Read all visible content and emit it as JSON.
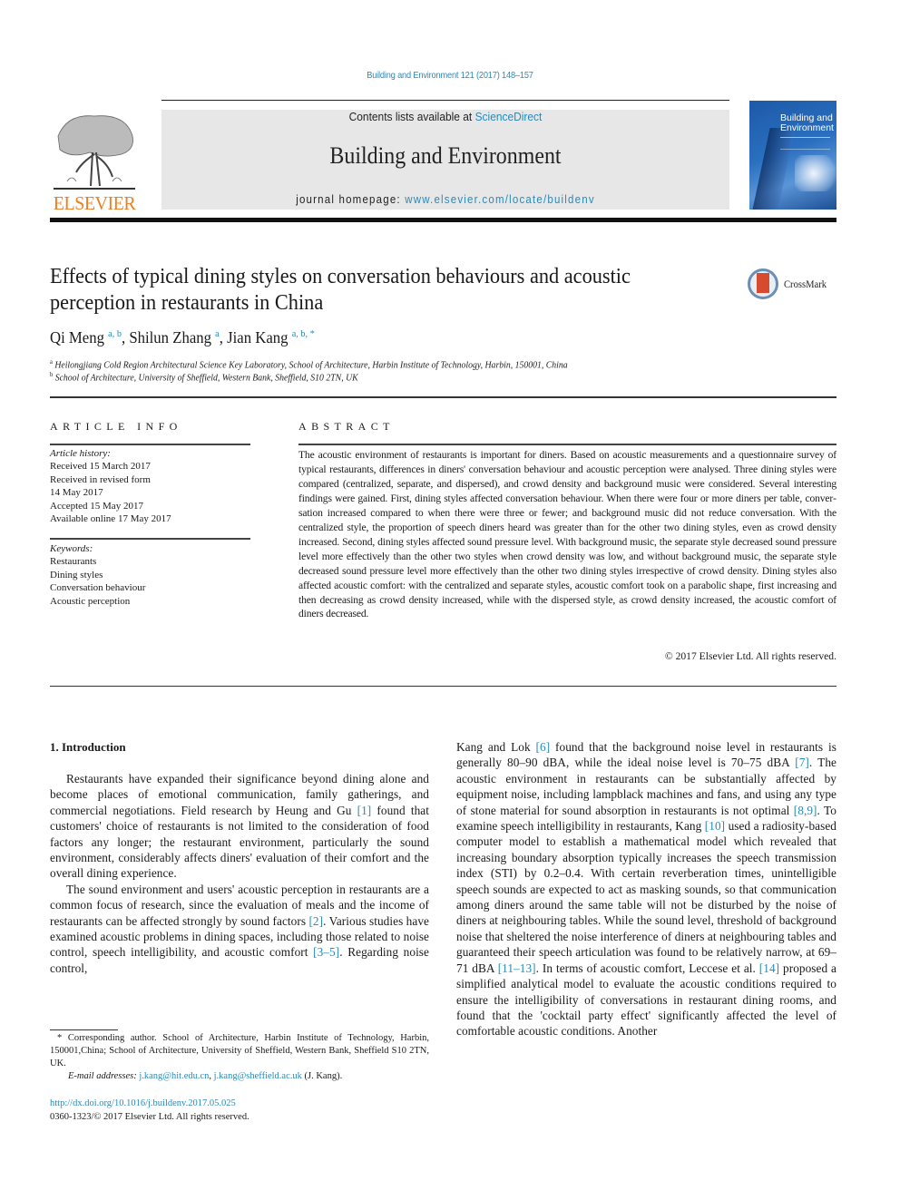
{
  "header": {
    "citation": "Building and Environment 121 (2017) 148–157",
    "contents_prefix": "Contents lists available at ",
    "contents_link": "ScienceDirect",
    "journal_name": "Building and Environment",
    "homepage_prefix": "journal homepage: ",
    "homepage_link": "www.elsevier.com/locate/buildenv",
    "publisher_logo_text": "ELSEVIER",
    "cover_title": "Building and Environment",
    "crossmark_label": "CrossMark",
    "colors": {
      "link": "#2a8ab8",
      "elsevier_orange": "#f07e1e",
      "masthead_bg": "#e7e7e7"
    }
  },
  "article": {
    "title": "Effects of typical dining styles on conversation behaviours and acoustic perception in restaurants in China",
    "authors": [
      {
        "name": "Qi Meng",
        "affils": "a, b"
      },
      {
        "name": "Shilun Zhang",
        "affils": "a"
      },
      {
        "name": "Jian Kang",
        "affils": "a, b, *"
      }
    ],
    "affiliations": [
      {
        "mark": "a",
        "text": "Heilongjiang Cold Region Architectural Science Key Laboratory, School of Architecture, Harbin Institute of Technology, Harbin, 150001, China"
      },
      {
        "mark": "b",
        "text": "School of Architecture, University of Sheffield, Western Bank, Sheffield, S10 2TN, UK"
      }
    ]
  },
  "article_info": {
    "heading": "ARTICLE INFO",
    "history_label": "Article history:",
    "history": [
      "Received 15 March 2017",
      "Received in revised form",
      "14 May 2017",
      "Accepted 15 May 2017",
      "Available online 17 May 2017"
    ],
    "keywords_label": "Keywords:",
    "keywords": [
      "Restaurants",
      "Dining styles",
      "Conversation behaviour",
      "Acoustic perception"
    ]
  },
  "abstract": {
    "heading": "ABSTRACT",
    "text": "The acoustic environment of restaurants is important for diners. Based on acoustic measurements and a questionnaire survey of typical restaurants, differences in diners' conversation behaviour and acoustic perception were analysed. Three dining styles were compared (centralized, separate, and dispersed), and crowd density and background music were considered. Several interesting findings were gained. First, dining styles affected conversation behaviour. When there were four or more diners per table, conver­sation increased compared to when there were three or fewer; and background music did not reduce conversation. With the centralized style, the proportion of speech diners heard was greater than for the other two dining styles, even as crowd density increased. Second, dining styles affected sound pressure level. With background music, the separate style decreased sound pressure level more effectively than the other two styles when crowd density was low, and without background music, the separate style decreased sound pressure level more effectively than the other two dining styles irrespective of crowd density. Dining styles also affected acoustic comfort: with the centralized and separate styles, acoustic comfort took on a parabolic shape, first increasing and then decreasing as crowd density increased, while with the dispersed style, as crowd density increased, the acoustic comfort of diners decreased.",
    "copyright": "© 2017 Elsevier Ltd. All rights reserved."
  },
  "body": {
    "intro_heading": "1.  Introduction",
    "left_paragraphs": [
      [
        {
          "t": "Restaurants have expanded their significance beyond dining alone and become places of emotional communication, family gatherings, and commercial negotiations. Field research by Heung and Gu "
        },
        {
          "ref": "[1]"
        },
        {
          "t": " found that customers' choice of restaurants is not limited to the consideration of food factors any longer; the restaurant environment, particularly the sound environment, considerably affects diners' evaluation of their comfort and the overall dining experience."
        }
      ],
      [
        {
          "t": "The sound environment and users' acoustic perception in res­taurants are a common focus of research, since the evaluation of meals and the income of restaurants can be affected strongly by sound factors "
        },
        {
          "ref": "[2]"
        },
        {
          "t": ". Various studies have examined acoustic problems in dining spaces, including those related to noise control, speech intelligibility, and acoustic comfort "
        },
        {
          "ref": "[3–5]"
        },
        {
          "t": ". Regarding noise control,"
        }
      ]
    ],
    "right_paragraph": [
      {
        "t": "Kang and Lok "
      },
      {
        "ref": "[6]"
      },
      {
        "t": " found that the background noise level in restau­rants is generally 80–90 dBA, while the ideal noise level is 70–75 dBA "
      },
      {
        "ref": "[7]"
      },
      {
        "t": ". The acoustic environment in restaurants can be substan­tially affected by equipment noise, including lampblack machines and fans, and using any type of stone material for sound absorption in restaurants is not optimal "
      },
      {
        "ref": "[8,9]"
      },
      {
        "t": ". To examine speech intelligibility in restaurants, Kang "
      },
      {
        "ref": "[10]"
      },
      {
        "t": " used a radiosity-based computer model to establish a mathematical model which revealed that increasing boundary absorption typically increases the speech transmission index (STI) by 0.2–0.4. With certain reverberation times, unintel­ligible speech sounds are expected to act as masking sounds, so that communication among diners around the same table will not be disturbed by the noise of diners at neighbouring tables. While the sound level, threshold of background noise that sheltered the noise interference of diners at neighbouring tables and guaranteed their speech articulation was found to be relatively narrow, at 69–71 dBA "
      },
      {
        "ref": "[11–13]"
      },
      {
        "t": ". In terms of acoustic comfort, Leccese et al. "
      },
      {
        "ref": "[14]"
      },
      {
        "t": " proposed a simplified analytical model to evaluate the acoustic conditions required to ensure the intelligibility of conversations in restaurant dining rooms, and found that the 'cocktail party effect' significantly affected the level of comfortable acoustic conditions. Another"
      }
    ]
  },
  "footnote": {
    "corresponding": "* Corresponding author. School of Architecture, Harbin Institute of Technology, Harbin, 150001,China; School of Architecture, University of Sheffield, Western Bank, Sheffield S10 2TN, UK.",
    "email_label": "E-mail addresses:",
    "emails": [
      "j.kang@hit.edu.cn",
      "j.kang@sheffield.ac.uk"
    ],
    "email_suffix": " (J. Kang).",
    "doi": "http://dx.doi.org/10.1016/j.buildenv.2017.05.025",
    "issn": "0360-1323/© 2017 Elsevier Ltd. All rights reserved."
  }
}
